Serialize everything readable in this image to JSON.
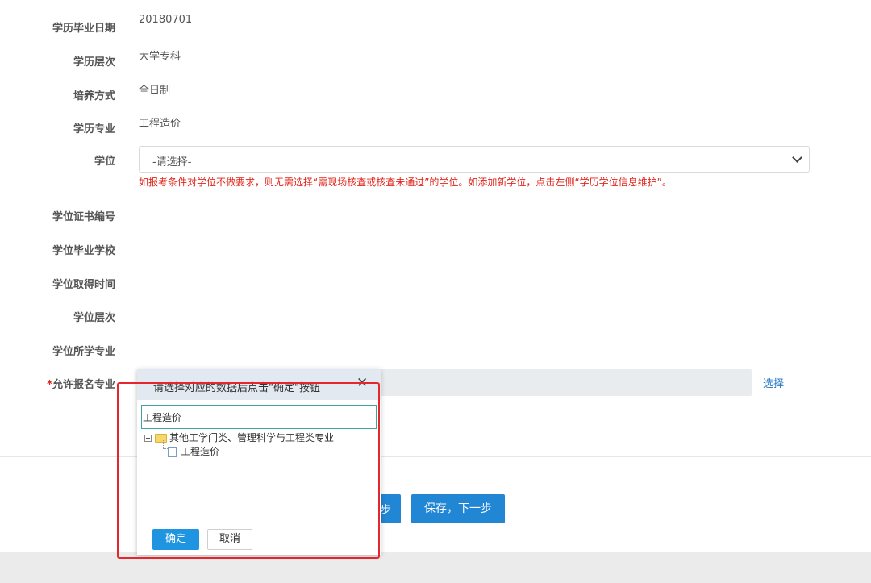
{
  "form": {
    "rows": [
      {
        "label": "学历毕业日期",
        "value": "20180701"
      },
      {
        "label": "学历层次",
        "value": "大学专科"
      },
      {
        "label": "培养方式",
        "value": "全日制"
      },
      {
        "label": "学历专业",
        "value": "工程造价"
      }
    ],
    "degree_label": "学位",
    "degree_select_value": "-请选择-",
    "degree_hint": "如报考条件对学位不做要求，则无需选择“需现场核查或核查未通过”的学位。如添加新学位，点击左侧“学历学位信息维护”。",
    "degree_fields": [
      "学位证书编号",
      "学位毕业学校",
      "学位取得时间",
      "学位层次",
      "学位所学专业"
    ],
    "allowed_major_required": "*",
    "allowed_major_label": "允许报名专业",
    "select_link": "选择"
  },
  "actions": {
    "prev_label": "步",
    "save_next_label": "保存，下一步"
  },
  "dialog": {
    "title": "请选择对应的数据后点击\"确定\"按钮",
    "close": "✕",
    "search_value": "工程造价",
    "tree": {
      "parent": "其他工学门类、管理科学与工程类专业",
      "child": "工程造价"
    },
    "ok_label": "确定",
    "cancel_label": "取消"
  },
  "colors": {
    "primary": "#2186d4",
    "hint_red": "#e1251b",
    "highlight_border": "#e5262a",
    "link": "#2a7ac8"
  }
}
